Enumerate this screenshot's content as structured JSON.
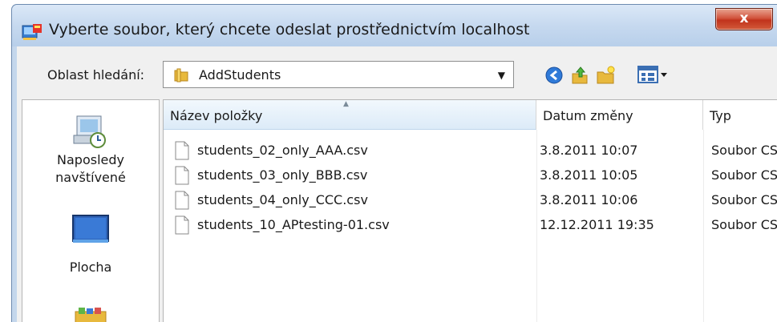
{
  "window": {
    "title": "Vyberte soubor, který chcete odeslat prostřednictvím localhost",
    "close_label": "x"
  },
  "lookin": {
    "label": "Oblast hledání:",
    "current_folder": "AddStudents"
  },
  "places": [
    {
      "label_line1": "Naposledy",
      "label_line2": "navštívené",
      "icon": "recent-places-icon"
    },
    {
      "label_line1": "Plocha",
      "label_line2": "",
      "icon": "desktop-icon"
    },
    {
      "label_line1": "",
      "label_line2": "",
      "icon": "libraries-icon"
    }
  ],
  "columns": {
    "name": "Název položky",
    "date": "Datum změny",
    "type": "Typ"
  },
  "files": [
    {
      "name": "students_02_only_AAA.csv",
      "date": "3.8.2011 10:07",
      "type": "Soubor CS"
    },
    {
      "name": "students_03_only_BBB.csv",
      "date": "3.8.2011 10:05",
      "type": "Soubor CS"
    },
    {
      "name": "students_04_only_CCC.csv",
      "date": "3.8.2011 10:06",
      "type": "Soubor CS"
    },
    {
      "name": "students_10_APtesting-01.csv",
      "date": "12.12.2011 19:35",
      "type": "Soubor CS"
    }
  ],
  "colors": {
    "titlebar": "#c6d9ef",
    "close_button": "#c1331c",
    "header_sorted": "#dcebf8"
  }
}
